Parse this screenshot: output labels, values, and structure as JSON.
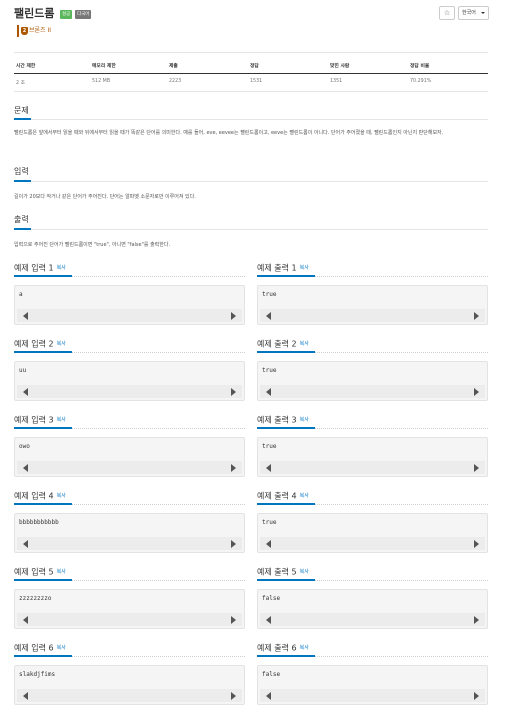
{
  "header": {
    "title": "팰린드롬",
    "badge_success": "성공",
    "badge_multilang": "다국어",
    "star_icon": "☆",
    "language_button": "한국어",
    "tier_label": "브론즈 II",
    "tier_number": "2"
  },
  "stats": {
    "headers": [
      "시간 제한",
      "메모리 제한",
      "제출",
      "정답",
      "맞힌 사람",
      "정답 비율"
    ],
    "values": [
      "2 초",
      "512 MB",
      "2223",
      "1531",
      "1351",
      "70.291%"
    ]
  },
  "sections": {
    "problem_title": "문제",
    "problem_text": "팰린드롬은 앞에서부터 읽을 때와 뒤에서부터 읽을 때가 똑같은 단어를 의미한다. 예를 들어, eve, eevee는 팰린드롬이고, eeve는 팰린드롬이 아니다. 단어가 주어졌을 때, 팰린드롬인지 아닌지 판단해보자.",
    "input_title": "입력",
    "input_text": "길이가 20보다 작거나 같은 단어가 주어진다. 단어는 알파벳 소문자로만 이루어져 있다.",
    "output_title": "출력",
    "output_text": "입력으로 주어진 단어가 팰린드롬이면 \"true\", 아니면 \"false\"를 출력한다."
  },
  "copy_label": "복사",
  "examples": [
    {
      "in_title": "예제 입력 1",
      "in_value": "a",
      "out_title": "예제 출력 1",
      "out_value": "true"
    },
    {
      "in_title": "예제 입력 2",
      "in_value": "uu",
      "out_title": "예제 출력 2",
      "out_value": "true"
    },
    {
      "in_title": "예제 입력 3",
      "in_value": "owo",
      "out_title": "예제 출력 3",
      "out_value": "true"
    },
    {
      "in_title": "예제 입력 4",
      "in_value": "bbbbbbbbbbb",
      "out_title": "예제 출력 4",
      "out_value": "true"
    },
    {
      "in_title": "예제 입력 5",
      "in_value": "zzzzzzzzo",
      "out_title": "예제 출력 5",
      "out_value": "false"
    },
    {
      "in_title": "예제 입력 6",
      "in_value": "slakdjfims",
      "out_title": "예제 출력 6",
      "out_value": "false"
    }
  ]
}
